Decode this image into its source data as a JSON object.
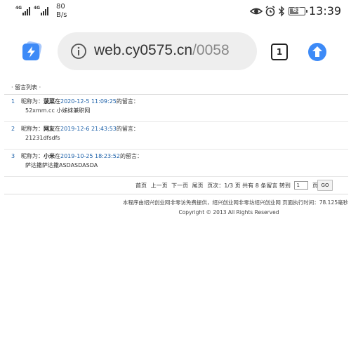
{
  "status_bar": {
    "signal_1_label": "4G",
    "signal_2_label": "4G",
    "speed_value": "80",
    "speed_unit": "B/s",
    "battery": "63",
    "battery_level": 0.63,
    "time": "13:39",
    "icons": [
      "eye-icon",
      "alarm-icon",
      "bluetooth-icon",
      "battery-icon"
    ]
  },
  "browser": {
    "url_host": "web.cy0575.cn",
    "url_path": "/0058",
    "tab_count": "1",
    "icons": [
      "app-logo-icon",
      "info-icon",
      "tabs-icon",
      "upload-icon"
    ],
    "colors": {
      "accent": "#3d8af7",
      "url_bg": "#eeeeee"
    }
  },
  "page": {
    "section_title": "留言列表",
    "entries": [
      {
        "num": "1",
        "prefix": "昵称为：",
        "name": "菠菜",
        "at": "在",
        "date": "2020-12-5 11:09:25",
        "suffix": "的留言：",
        "message": "52xmm.cc 小姊妹兼职网"
      },
      {
        "num": "2",
        "prefix": "昵称为：",
        "name": "网友",
        "at": "在",
        "date": "2019-12-6 21:43:53",
        "suffix": "的留言：",
        "message": "21231dfsdfs"
      },
      {
        "num": "3",
        "prefix": "昵称为：",
        "name": "小米",
        "at": "在",
        "date": "2019-10-25 18:23:52",
        "suffix": "的留言：",
        "message": "萨达撒萨达撒ASDASDASDA"
      }
    ],
    "pager": {
      "first": "首页",
      "prev": "上一页",
      "next": "下一页",
      "last": "尾页",
      "page_info": "页次：1/3 页 共有 8 条留言 转到",
      "page_input_value": "1",
      "page_unit": "页",
      "go_label": "GO"
    },
    "footer": {
      "line1": "本程序由绍兴创业网非零访免费提供，绍兴创业网非零坊绍兴创业网    页面执行时间：78.125毫秒",
      "line2": "Copyright © 2013 All Rights Reserved"
    }
  }
}
